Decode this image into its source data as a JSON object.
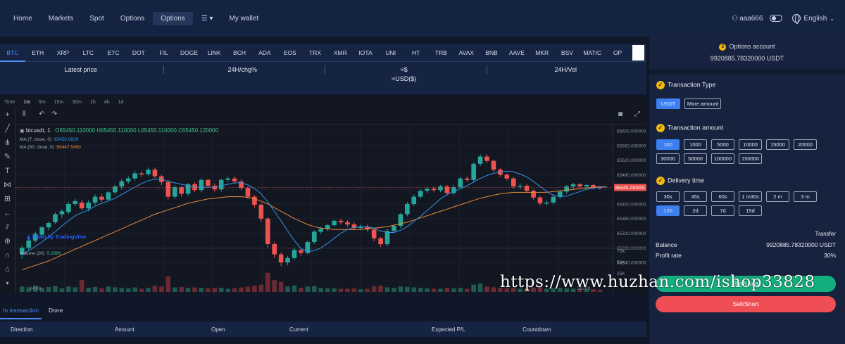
{
  "nav": {
    "items": [
      "Home",
      "Markets",
      "Spot",
      "Options",
      "Options",
      "My wallet"
    ],
    "active_index": 4,
    "user": "aaa666",
    "language": "English"
  },
  "coins": [
    "BTC",
    "ETH",
    "XRP",
    "LTC",
    "ETC",
    "DOT",
    "FIL",
    "DOGE",
    "LINK",
    "BCH",
    "ADA",
    "EOS",
    "TRX",
    "XMR",
    "IOTA",
    "UNI",
    "HT",
    "TRB",
    "AVAX",
    "BNB",
    "AAVE",
    "MKR",
    "BSV",
    "MATIC",
    "OP"
  ],
  "active_coin": "BTC",
  "ticker": {
    "latest_price_label": "Latest price",
    "change_label": "24H/chg%",
    "approx_line1": "≈$",
    "approx_line2": "≈USD($)",
    "vol_label": "24H/Vol"
  },
  "chart": {
    "timeframes": [
      "Time",
      "1m",
      "5m",
      "15m",
      "30m",
      "1h",
      "4h",
      "1d"
    ],
    "selected_timeframe": "1m",
    "symbol": "btcusdt, 1",
    "ohlc": {
      "open_label": "O",
      "open": "65450.110000",
      "high_label": "H",
      "high": "65450.110000",
      "low_label": "L",
      "low": "65450.110000",
      "close_label": "C",
      "close": "65450.120000"
    },
    "ma7_label": "MA (7, close, 0)",
    "ma7_value": "65450.0829",
    "ma30_label": "MA (30, close, 0)",
    "ma30_value": "65447.5490",
    "brand": "Chart by TradingView",
    "volume_label": "Volume (20)",
    "volume_value": "5.286K",
    "current_price": "65445.240000",
    "x_tick": "14:00",
    "x_right": "56709",
    "colors": {
      "up": "#26a69a",
      "down": "#ef5350",
      "ma7": "#2f95e6",
      "ma30": "#e98a3b",
      "price_tag": "#ef5350"
    }
  },
  "chart_data": {
    "type": "candlestick",
    "y_ticks": [
      "65600.000000",
      "65560.000000",
      "65520.000000",
      "65480.000000",
      "65440.000000",
      "65400.000000",
      "65360.000000",
      "65320.000000",
      "65280.000000",
      "65240.000000"
    ],
    "ylim": [
      65215,
      65610
    ],
    "volume_ticks": [
      "75K",
      "50K",
      "25K"
    ],
    "volume_max": 80,
    "candles": [
      [
        65262,
        65280,
        65250,
        65286,
        12
      ],
      [
        65280,
        65300,
        65274,
        65304,
        10
      ],
      [
        65300,
        65318,
        65294,
        65324,
        14
      ],
      [
        65316,
        65336,
        65310,
        65340,
        9
      ],
      [
        65336,
        65348,
        65328,
        65352,
        11
      ],
      [
        65350,
        65372,
        65346,
        65378,
        13
      ],
      [
        65372,
        65380,
        65362,
        65386,
        8
      ],
      [
        65378,
        65400,
        65372,
        65406,
        12
      ],
      [
        65400,
        65408,
        65394,
        65414,
        10
      ],
      [
        65404,
        65388,
        65382,
        65412,
        26
      ],
      [
        65388,
        65404,
        65380,
        65410,
        9
      ],
      [
        65404,
        65420,
        65398,
        65426,
        11
      ],
      [
        65420,
        65412,
        65406,
        65428,
        8
      ],
      [
        65412,
        65432,
        65408,
        65436,
        12
      ],
      [
        65432,
        65448,
        65426,
        65452,
        10
      ],
      [
        65448,
        65462,
        65440,
        65468,
        9
      ],
      [
        65462,
        65470,
        65456,
        65476,
        8
      ],
      [
        65470,
        65484,
        65464,
        65490,
        10
      ],
      [
        65484,
        65482,
        65474,
        65490,
        7
      ],
      [
        65482,
        65494,
        65476,
        65500,
        9
      ],
      [
        65494,
        65476,
        65470,
        65500,
        14
      ],
      [
        65476,
        65460,
        65452,
        65480,
        12
      ],
      [
        65460,
        65420,
        65412,
        65466,
        34
      ],
      [
        65420,
        65446,
        65414,
        65452,
        10
      ],
      [
        65446,
        65428,
        65420,
        65450,
        11
      ],
      [
        65428,
        65454,
        65422,
        65458,
        9
      ],
      [
        65454,
        65438,
        65432,
        65460,
        10
      ],
      [
        65438,
        65466,
        65432,
        65470,
        9
      ],
      [
        65466,
        65450,
        65444,
        65470,
        8
      ],
      [
        65450,
        65440,
        65434,
        65456,
        9
      ],
      [
        65440,
        65466,
        65434,
        65470,
        9
      ],
      [
        65466,
        65470,
        65460,
        65476,
        7
      ],
      [
        65470,
        65462,
        65456,
        65476,
        8
      ],
      [
        65462,
        65444,
        65438,
        65468,
        10
      ],
      [
        65444,
        65420,
        65414,
        65448,
        12
      ],
      [
        65420,
        65398,
        65390,
        65424,
        14
      ],
      [
        65398,
        65360,
        65352,
        65402,
        16
      ],
      [
        65360,
        65290,
        65280,
        65364,
        42
      ],
      [
        65290,
        65262,
        65252,
        65296,
        26
      ],
      [
        65262,
        65240,
        65230,
        65268,
        22
      ],
      [
        65240,
        65252,
        65232,
        65258,
        12
      ],
      [
        65252,
        65274,
        65246,
        65280,
        14
      ],
      [
        65274,
        65266,
        65258,
        65280,
        9
      ],
      [
        65266,
        65296,
        65262,
        65300,
        12
      ],
      [
        65296,
        65324,
        65290,
        65328,
        13
      ],
      [
        65324,
        65332,
        65318,
        65338,
        9
      ],
      [
        65332,
        65342,
        65326,
        65346,
        8
      ],
      [
        65342,
        65354,
        65338,
        65358,
        8
      ],
      [
        65354,
        65350,
        65344,
        65360,
        7
      ],
      [
        65350,
        65344,
        65338,
        65356,
        7
      ],
      [
        65344,
        65334,
        65328,
        65350,
        8
      ],
      [
        65334,
        65338,
        65330,
        65344,
        6
      ],
      [
        65338,
        65330,
        65324,
        65344,
        7
      ],
      [
        65330,
        65306,
        65298,
        65334,
        12
      ],
      [
        65306,
        65290,
        65282,
        65310,
        14
      ],
      [
        65290,
        65326,
        65284,
        65332,
        10
      ],
      [
        65326,
        65340,
        65320,
        65346,
        9
      ],
      [
        65340,
        65372,
        65334,
        65376,
        12
      ],
      [
        65372,
        65400,
        65366,
        65406,
        11
      ],
      [
        65400,
        65420,
        65394,
        65426,
        10
      ],
      [
        65420,
        65436,
        65414,
        65440,
        9
      ],
      [
        65436,
        65442,
        65430,
        65448,
        8
      ],
      [
        65442,
        65438,
        65432,
        65448,
        7
      ],
      [
        65438,
        65448,
        65432,
        65452,
        7
      ],
      [
        65448,
        65430,
        65424,
        65452,
        9
      ],
      [
        65430,
        65446,
        65424,
        65452,
        8
      ],
      [
        65446,
        65470,
        65440,
        65474,
        9
      ],
      [
        65470,
        65466,
        65460,
        65476,
        7
      ],
      [
        65466,
        65510,
        65460,
        65514,
        16
      ],
      [
        65510,
        65530,
        65504,
        65536,
        18
      ],
      [
        65530,
        65518,
        65512,
        65536,
        12
      ],
      [
        65518,
        65494,
        65488,
        65522,
        10
      ],
      [
        65494,
        65480,
        65474,
        65498,
        9
      ],
      [
        65480,
        65470,
        65464,
        65484,
        8
      ],
      [
        65470,
        65448,
        65442,
        65474,
        9
      ],
      [
        65448,
        65450,
        65440,
        65456,
        7
      ],
      [
        65450,
        65436,
        65430,
        65454,
        8
      ],
      [
        65436,
        65418,
        65412,
        65440,
        9
      ],
      [
        65418,
        65402,
        65396,
        65422,
        10
      ],
      [
        65402,
        65404,
        65396,
        65410,
        7
      ],
      [
        65404,
        65420,
        65398,
        65426,
        8
      ],
      [
        65420,
        65434,
        65414,
        65438,
        9
      ],
      [
        65434,
        65448,
        65428,
        65452,
        8
      ],
      [
        65448,
        65454,
        65440,
        65458,
        7
      ],
      [
        65454,
        65448,
        65442,
        65458,
        6
      ],
      [
        65448,
        65452,
        65442,
        65456,
        6
      ],
      [
        65452,
        65446,
        65440,
        65456,
        6
      ],
      [
        65446,
        65445,
        65440,
        65450,
        5
      ]
    ],
    "ma7_series": [
      65262,
      65272,
      65284,
      65296,
      65310,
      65324,
      65340,
      65354,
      65368,
      65376,
      65384,
      65394,
      65402,
      65408,
      65416,
      65426,
      65436,
      65446,
      65456,
      65464,
      65468,
      65468,
      65462,
      65458,
      65454,
      65450,
      65446,
      65446,
      65446,
      65446,
      65450,
      65454,
      65458,
      65458,
      65452,
      65442,
      65428,
      65406,
      65380,
      65354,
      65326,
      65300,
      65278,
      65270,
      65272,
      65280,
      65292,
      65306,
      65320,
      65330,
      65336,
      65338,
      65338,
      65334,
      65326,
      65322,
      65322,
      65328,
      65338,
      65352,
      65366,
      65382,
      65398,
      65414,
      65426,
      65434,
      65442,
      65450,
      65460,
      65470,
      65478,
      65484,
      65488,
      65490,
      65488,
      65482,
      65474,
      65462,
      65448,
      65434,
      65424,
      65420,
      65422,
      65428,
      65434,
      65440,
      65444,
      65446,
      65446
    ],
    "ma30_series": [
      65220,
      65226,
      65232,
      65238,
      65244,
      65252,
      65260,
      65268,
      65276,
      65284,
      65292,
      65300,
      65308,
      65316,
      65324,
      65332,
      65340,
      65348,
      65356,
      65364,
      65372,
      65378,
      65384,
      65390,
      65396,
      65402,
      65406,
      65410,
      65414,
      65416,
      65418,
      65420,
      65420,
      65420,
      65418,
      65414,
      65408,
      65400,
      65390,
      65380,
      65370,
      65360,
      65352,
      65344,
      65338,
      65334,
      65332,
      65330,
      65330,
      65330,
      65330,
      65330,
      65332,
      65334,
      65336,
      65338,
      65342,
      65346,
      65350,
      65356,
      65362,
      65368,
      65374,
      65380,
      65386,
      65392,
      65398,
      65404,
      65410,
      65416,
      65420,
      65424,
      65428,
      65430,
      65432,
      65432,
      65432,
      65432,
      65432,
      65432,
      65434,
      65436,
      65438,
      65440,
      65442,
      65444,
      65446,
      65447,
      65447
    ]
  },
  "bottom": {
    "tabs": [
      "In transaction",
      "Done"
    ],
    "columns": [
      "Direction",
      "Amount",
      "Open",
      "Current",
      "Expected P/L",
      "Countdown"
    ]
  },
  "panel": {
    "account_title": "Options account",
    "account_balance": "9920885.78320000 USDT",
    "transaction_type_title": "Transaction Type",
    "types": [
      "USDT",
      "More amount"
    ],
    "selected_type": "USDT",
    "amount_title": "Transaction amount",
    "amounts": [
      "100",
      "1000",
      "5000",
      "10000",
      "15000",
      "20000",
      "30000",
      "50000",
      "100000",
      "150000"
    ],
    "selected_amount": "100",
    "delivery_title": "Delivery time",
    "times": [
      "30s",
      "45s",
      "60s",
      "1 m30s",
      "2 m",
      "3 m",
      "12h",
      "2d",
      "7d",
      "15d"
    ],
    "selected_time": "12h",
    "transfer": "Transfer",
    "balance_label": "Balance",
    "balance_value": "9920885.78320000 USDT",
    "profit_label": "Profit rate",
    "profit_value": "30%",
    "buy_label": "Buy/Long",
    "sell_label": "Sell/Short",
    "colors": {
      "accent": "#3d7ef0",
      "buy": "#11b07e",
      "sell": "#ef4f54",
      "check": "#f0b90b"
    }
  },
  "watermark": "https://www.huzhan.com/ishop33828"
}
